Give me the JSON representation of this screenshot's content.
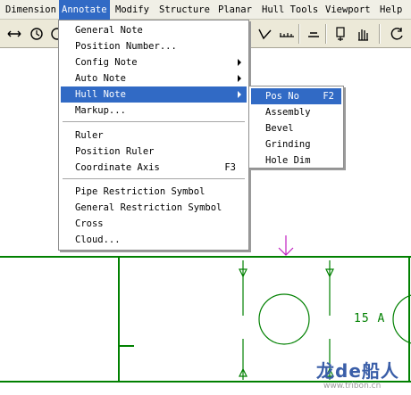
{
  "menubar": {
    "items": [
      "Dimension",
      "Annotate",
      "Modify",
      "Structure",
      "Planar",
      "Hull Tools",
      "Viewport",
      "Help"
    ],
    "active": "Annotate"
  },
  "annotate_menu": {
    "items": [
      "General Note",
      "Position Number...",
      "Config Note",
      "Auto Note",
      "Hull Note",
      "Markup...",
      "Ruler",
      "Position Ruler",
      "Coordinate Axis",
      "Pipe Restriction Symbol",
      "General Restriction Symbol",
      "Cross",
      "Cloud..."
    ],
    "coordinate_axis_shortcut": "F3",
    "highlighted": "Hull Note"
  },
  "hull_note_submenu": {
    "items": [
      "Pos No",
      "Assembly",
      "Bevel",
      "Grinding",
      "Hole Dim"
    ],
    "pos_no_shortcut": "F2",
    "highlighted": "Pos No"
  },
  "drawing": {
    "label": "15 A",
    "line_color": "#008000",
    "marker_color": "#c020c0"
  },
  "toolbar": {
    "icons": [
      "move-arrows-icon",
      "rotate-icon",
      "circle-icon",
      "dimension-icon",
      "ruler-icon",
      "line-icon",
      "stack-icon",
      "hand-icon",
      "rotate-view-icon"
    ]
  },
  "watermark": {
    "title": "龙de船人",
    "url": "www.tribon.cn"
  },
  "colors": {
    "menu_highlight": "#316ac5",
    "menubar_bg": "#f0efe6",
    "toolbar_bg": "#ece9d8"
  }
}
